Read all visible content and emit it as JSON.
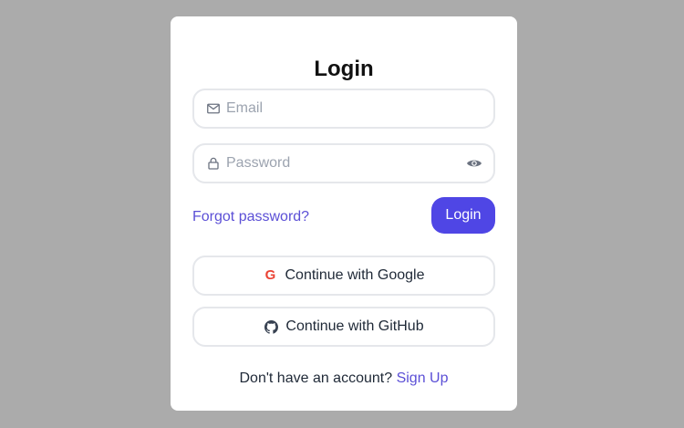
{
  "login_card": {
    "title": "Login",
    "email": {
      "placeholder": "Email",
      "value": "",
      "icon": "mail-icon"
    },
    "password": {
      "placeholder": "Password",
      "value": "",
      "icon": "lock-icon",
      "toggle_icon": "eye-icon"
    },
    "forgot_password_label": "Forgot password?",
    "login_button_label": "Login",
    "google_button_label": "Continue with Google",
    "google_icon": "google-icon",
    "github_button_label": "Continue with GitHub",
    "github_icon": "github-icon",
    "signup_prompt": "Don't have an account?",
    "signup_link_label": "Sign Up"
  },
  "colors": {
    "background": "#ababab",
    "card": "#ffffff",
    "accent": "#4f46e5",
    "link": "#5b4fd6",
    "border": "#e5e7eb",
    "google_red": "#ea4335"
  }
}
